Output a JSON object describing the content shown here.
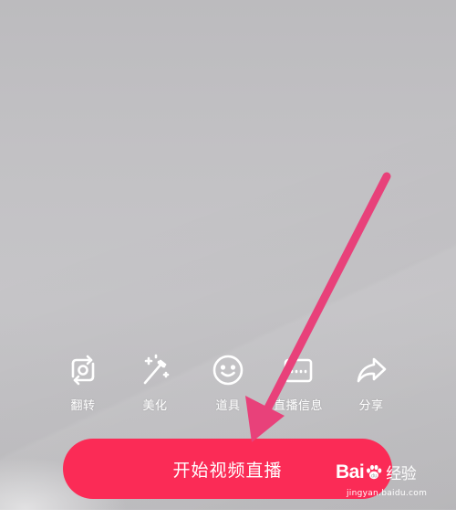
{
  "toolbar": {
    "items": [
      {
        "id": "flip",
        "label": "翻转",
        "icon": "camera-flip-icon"
      },
      {
        "id": "beauty",
        "label": "美化",
        "icon": "magic-wand-icon"
      },
      {
        "id": "props",
        "label": "道具",
        "icon": "smiley-face-icon"
      },
      {
        "id": "live_info",
        "label": "直播信息",
        "icon": "info-card-icon"
      },
      {
        "id": "share",
        "label": "分享",
        "icon": "share-arrow-icon"
      }
    ]
  },
  "start_button": {
    "label": "开始视频直播",
    "color": "#fb2b56"
  },
  "annotation": {
    "arrow_color": "#e8417a"
  },
  "watermark": {
    "brand_prefix": "Bai",
    "brand_suffix": "经验",
    "domain": "jingyan.baidu.com"
  },
  "colors": {
    "icon_color": "#ffffff",
    "background": "#c3c2c5"
  }
}
